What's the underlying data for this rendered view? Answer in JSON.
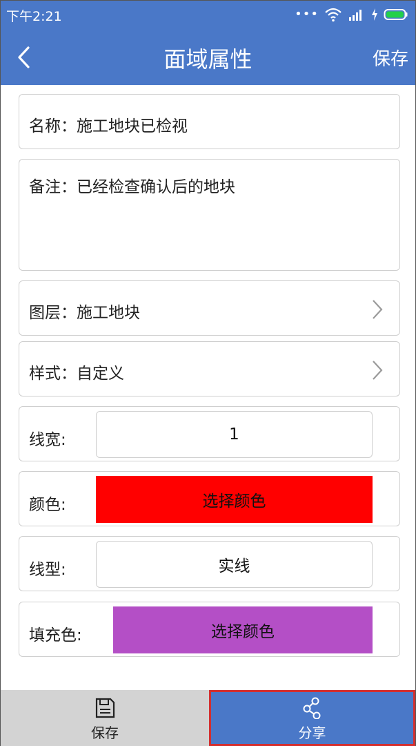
{
  "status_bar": {
    "time": "下午2:21"
  },
  "header": {
    "title": "面域属性",
    "save_label": "保存"
  },
  "form": {
    "name": "名称：施工地块已检视",
    "note": "备注：已经检查确认后的地块",
    "layer": "图层：施工地块",
    "style": "样式：自定义",
    "line_width": {
      "label": "线宽:",
      "value": "1"
    },
    "color": {
      "label": "颜色:",
      "button": "选择颜色",
      "swatch": "#ff0000"
    },
    "line_type": {
      "label": "线型:",
      "value": "实线"
    },
    "fill_color": {
      "label": "填充色:",
      "button": "选择颜色",
      "swatch": "#b44fc6"
    }
  },
  "bottom_bar": {
    "save_label": "保存",
    "share_label": "分享"
  },
  "colors": {
    "accent": "#4a78c8",
    "highlight_border": "#d32f2f"
  }
}
